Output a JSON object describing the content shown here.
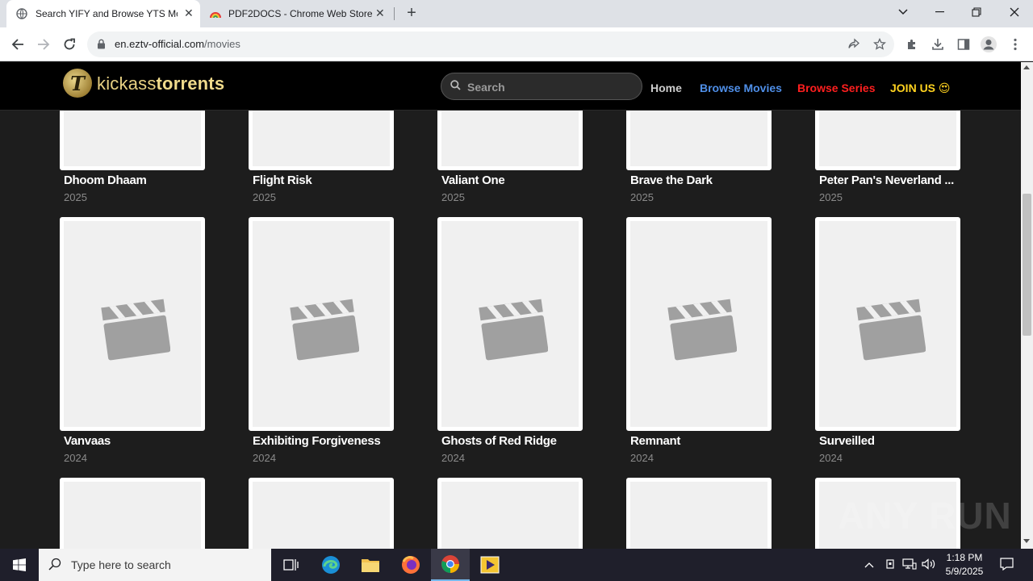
{
  "browser": {
    "tabs": [
      {
        "title": "Search YIFY and Browse YTS Mo",
        "active": true
      },
      {
        "title": "PDF2DOCS - Chrome Web Store",
        "active": false
      }
    ],
    "address": {
      "host": "en.eztv-official.com",
      "path": "/movies"
    }
  },
  "site": {
    "logo_light": "kickass",
    "logo_bold": "torrents",
    "logo_mark": "T",
    "search_placeholder": "Search",
    "nav": [
      {
        "label": "Home",
        "color": "#cccccc"
      },
      {
        "label": "Browse Movies",
        "color": "#4f8fe8"
      },
      {
        "label": "Browse Series",
        "color": "#ff1f1f"
      },
      {
        "label": "JOIN US 😍",
        "color": "#ffd21f"
      }
    ]
  },
  "movies": [
    {
      "title": "Dhoom Dhaam",
      "year": "2025"
    },
    {
      "title": "Flight Risk",
      "year": "2025"
    },
    {
      "title": "Valiant One",
      "year": "2025"
    },
    {
      "title": "Brave the Dark",
      "year": "2025"
    },
    {
      "title": "Peter Pan's Neverland ...",
      "year": "2025"
    },
    {
      "title": "Vanvaas",
      "year": "2024"
    },
    {
      "title": "Exhibiting Forgiveness",
      "year": "2024"
    },
    {
      "title": "Ghosts of Red Ridge",
      "year": "2024"
    },
    {
      "title": "Remnant",
      "year": "2024"
    },
    {
      "title": "Surveilled",
      "year": "2024"
    }
  ],
  "watermark": "ANY RUN",
  "taskbar": {
    "search_placeholder": "Type here to search",
    "time": "1:18 PM",
    "date": "5/9/2025"
  }
}
